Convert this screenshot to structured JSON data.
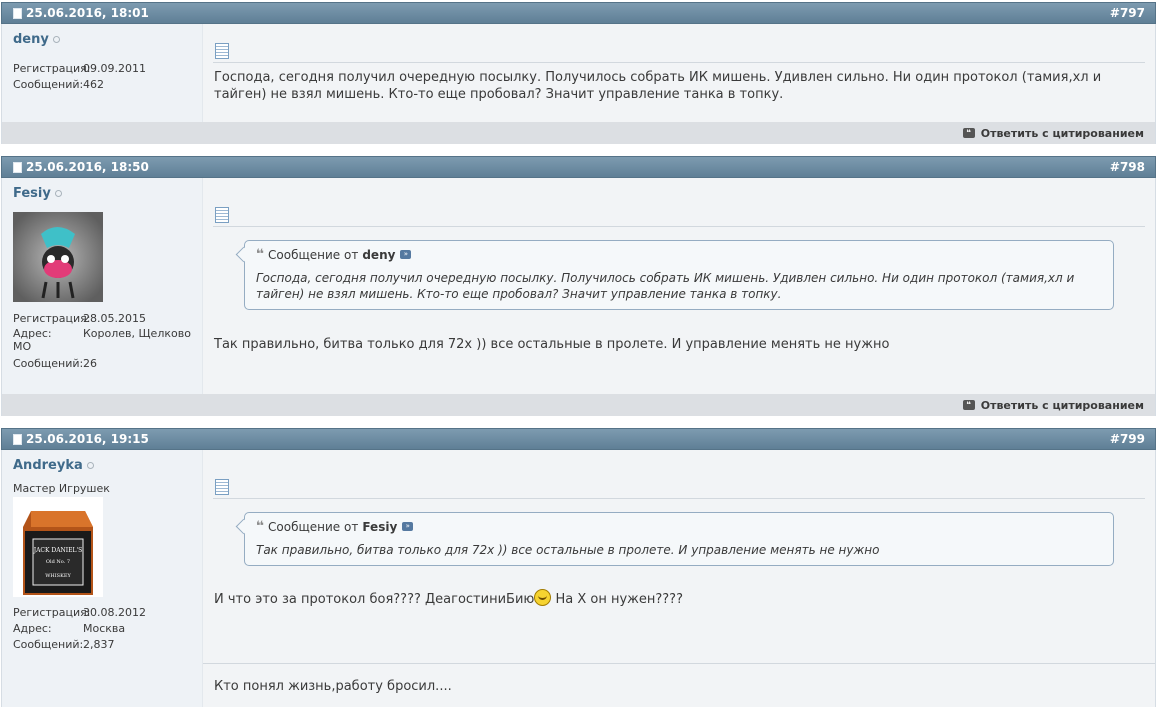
{
  "posts": [
    {
      "date": "25.06.2016, 18:01",
      "number": "#797",
      "username": "deny",
      "reg_label": "Регистрация:",
      "reg_value": "09.09.2011",
      "msgs_label": "Сообщений:",
      "msgs_value": "462",
      "message": "Господа, сегодня получил очередную посылку. Получилось собрать ИК мишень. Удивлен сильно. Ни один протокол (тамия,хл и тайген) не взял мишень. Кто-то еще пробовал? Значит управление танка в топку.",
      "reply_label": "Ответить с цитированием"
    },
    {
      "date": "25.06.2016, 18:50",
      "number": "#798",
      "username": "Fesiy",
      "reg_label": "Регистрация:",
      "reg_value": "28.05.2015",
      "addr_label": "Адрес:",
      "addr_value": "Королев, Щелково МО",
      "msgs_label": "Сообщений:",
      "msgs_value": "26",
      "quote_prefix": "Сообщение от",
      "quote_author": "deny",
      "quote_text": "Господа, сегодня получил очередную посылку. Получилось собрать ИК мишень. Удивлен сильно. Ни один протокол (тамия,хл и тайген) не взял мишень. Кто-то еще пробовал? Значит управление танка в топку.",
      "message": "Так правильно, битва только для 72х )) все остальные в пролете. И управление менять не нужно",
      "reply_label": "Ответить с цитированием"
    },
    {
      "date": "25.06.2016, 19:15",
      "number": "#799",
      "username": "Andreyka",
      "usertitle": "Мастер Игрушек",
      "reg_label": "Регистрация:",
      "reg_value": "30.08.2012",
      "addr_label": "Адрес:",
      "addr_value": "Москва",
      "msgs_label": "Сообщений:",
      "msgs_value": "2,837",
      "quote_prefix": "Сообщение от",
      "quote_author": "Fesiy",
      "quote_text": "Так правильно, битва только для 72х )) все остальные в пролете. И управление менять не нужно",
      "message_before": "И что это за протокол боя???? ДеагостиниБию",
      "message_after": "На Х он нужен????",
      "signature": "Кто понял жизнь,работу бросил...."
    }
  ],
  "colors": {
    "header": "#6b8ba3",
    "username": "#3f6a8a",
    "userinfo_bg": "#eef2f6",
    "content_bg": "#f2f4f6"
  }
}
